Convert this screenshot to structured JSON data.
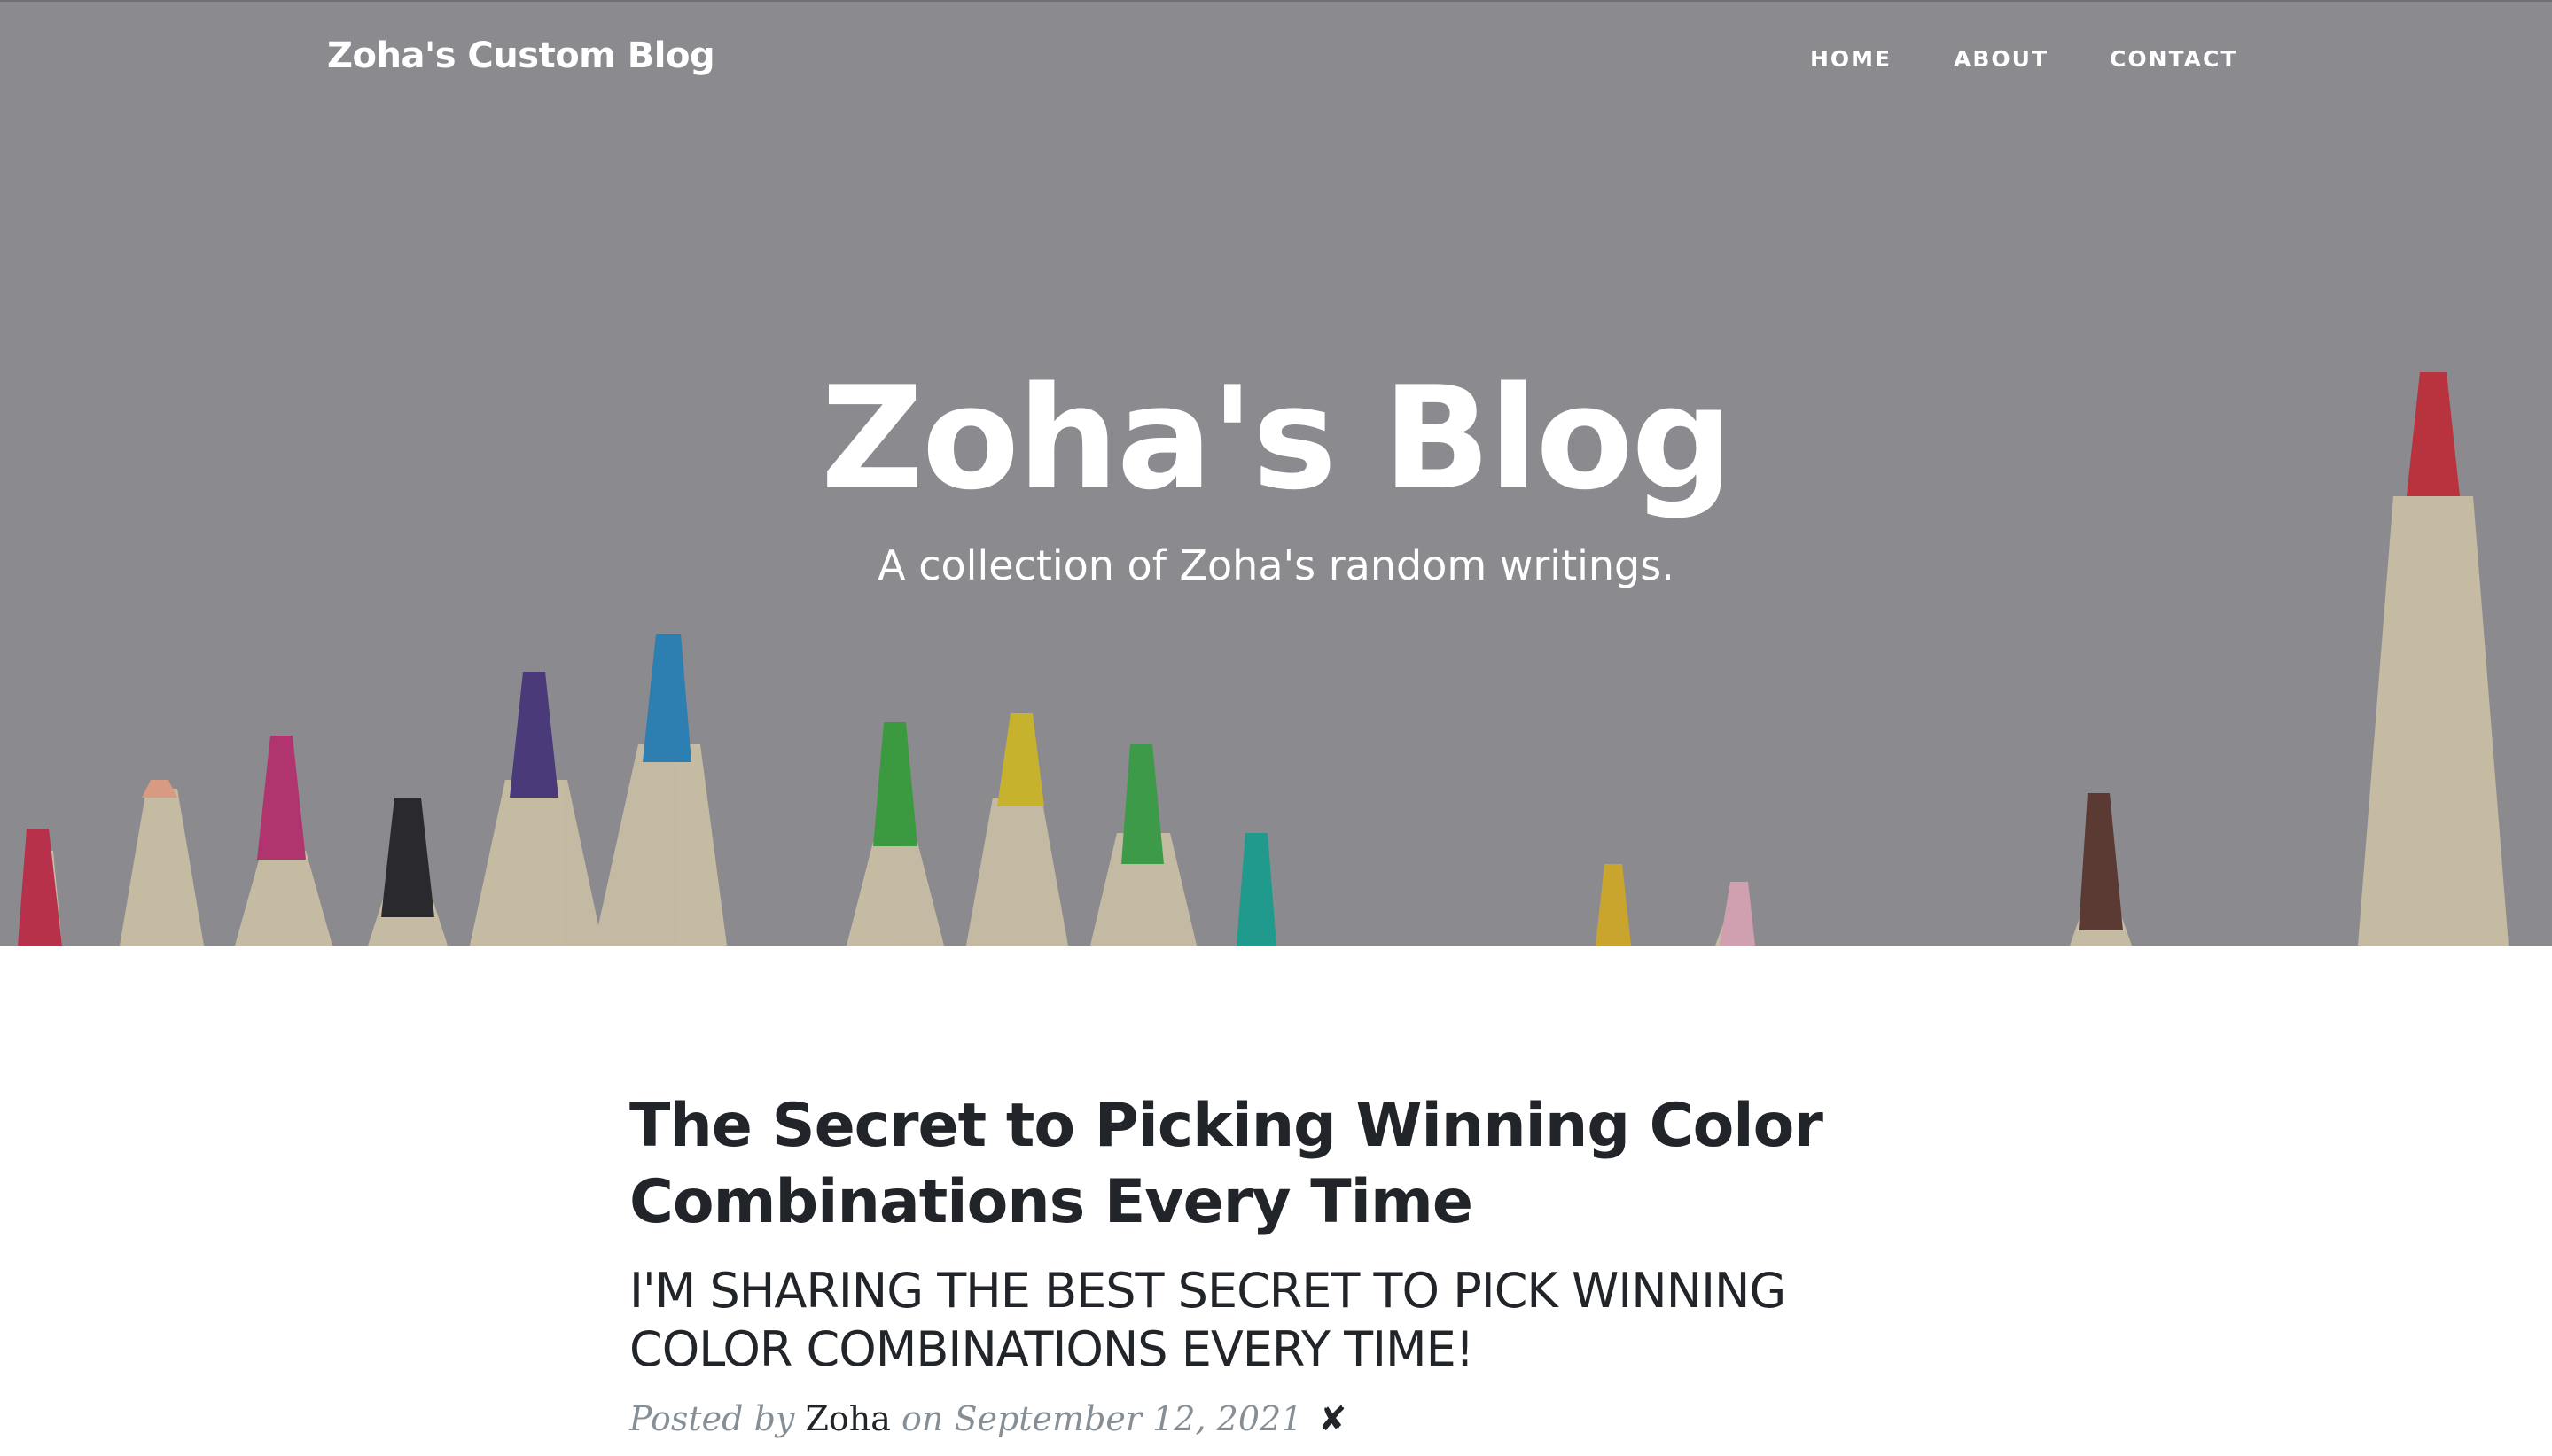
{
  "navbar": {
    "brand": "Zoha's Custom Blog",
    "links": [
      "HOME",
      "ABOUT",
      "CONTACT"
    ]
  },
  "hero": {
    "title": "Zoha's Blog",
    "subtitle": "A collection of Zoha's random writings.",
    "background_color": "#8b8a8f"
  },
  "post": {
    "title": "The Secret to Picking Winning Color Combinations Every Time",
    "subtitle": "I'M SHARING THE BEST SECRET TO PICK WINNING COLOR COMBINATIONS EVERY TIME!",
    "meta_prefix": "Posted by",
    "author": "Zoha",
    "meta_middle": "on",
    "date": "September 12, 2021",
    "delete_symbol": "✘"
  },
  "colors": {
    "text_dark": "#212529",
    "meta_gray": "#868e96"
  }
}
